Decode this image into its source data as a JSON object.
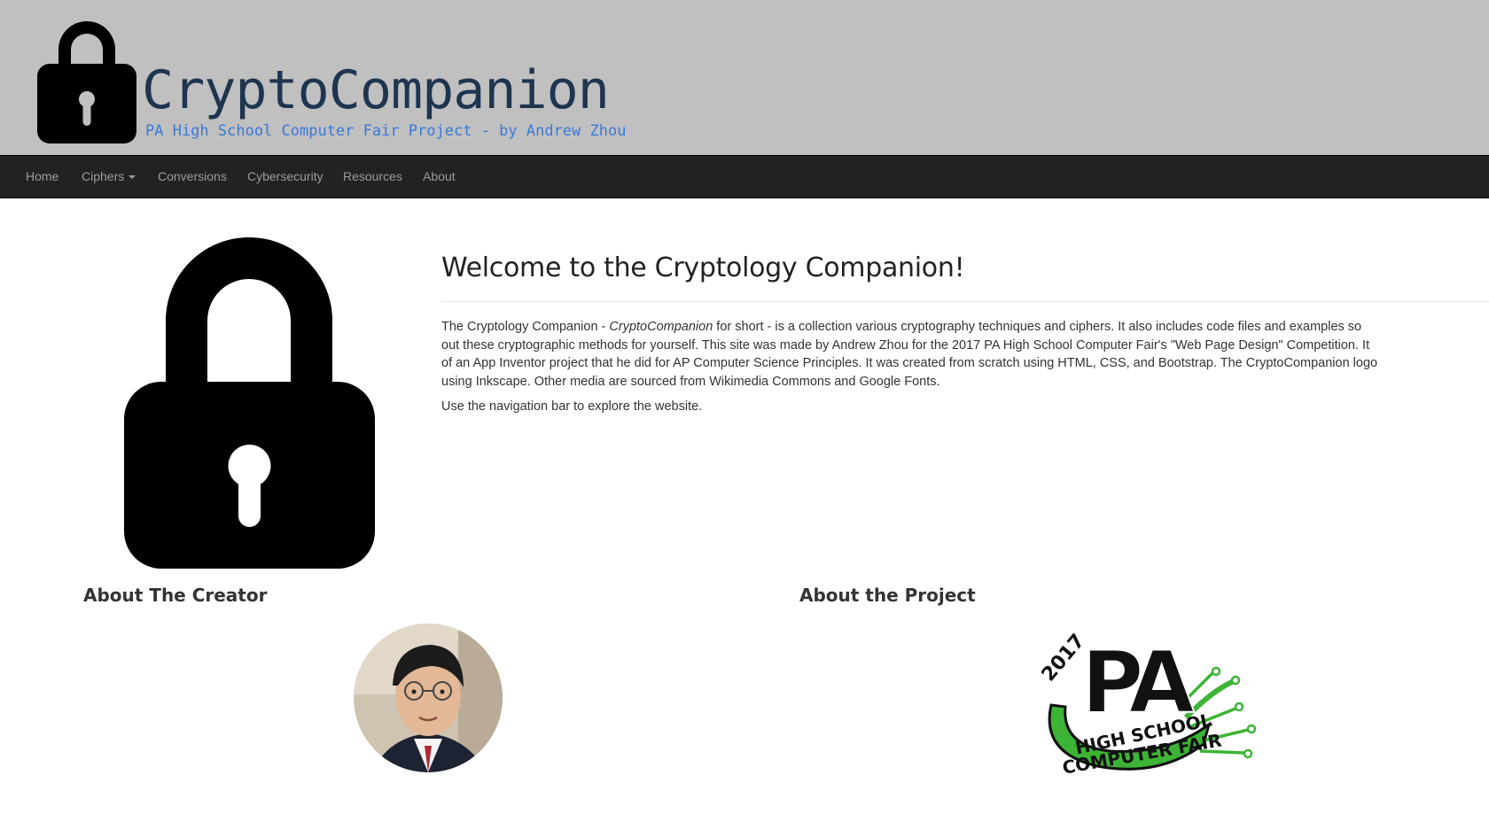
{
  "header": {
    "brand_title": "CryptoCompanion",
    "brand_subtitle": "PA High School Computer Fair Project - by Andrew Zhou",
    "banner_color": "#c0c0c0",
    "title_color": "#1e3550",
    "subtitle_color": "#3a78d8",
    "logo_icon": "padlock-icon"
  },
  "nav": {
    "items": [
      {
        "label": "Home"
      },
      {
        "label": "Ciphers",
        "has_dropdown": true
      },
      {
        "label": "Conversions"
      },
      {
        "label": "Cybersecurity"
      },
      {
        "label": "Resources"
      },
      {
        "label": "About"
      }
    ],
    "background": "#222222",
    "text_color": "#9d9d9d"
  },
  "main": {
    "hero_icon": "padlock-icon",
    "welcome_title": "Welcome to the Cryptology Companion!",
    "intro": {
      "line1_pre": "The Cryptology Companion - ",
      "line1_em": "CryptoCompanion",
      "line1_post": " for short - is a collection various cryptography techniques and ciphers. It also includes code files and examples so",
      "line2": "out these cryptographic methods for yourself. This site was made by Andrew Zhou for the 2017 PA High School Computer Fair's \"Web Page Design\" Competition. It",
      "line3": "of an App Inventor project that he did for AP Computer Science Principles. It was created from scratch using HTML, CSS, and Bootstrap. The CryptoCompanion logo",
      "line4": "using Inkscape. Other media are sourced from Wikimedia Commons and Google Fonts."
    },
    "nav_hint": "Use the navigation bar to explore the website."
  },
  "about_creator": {
    "heading": "About The Creator",
    "image": "creator-photo"
  },
  "about_project": {
    "heading": "About the Project",
    "logo_year": "2017",
    "logo_letters": "PA",
    "logo_line1": "HIGH SCHOOL",
    "logo_line2": "COMPUTER FAIR",
    "logo_color": "#3db435"
  }
}
